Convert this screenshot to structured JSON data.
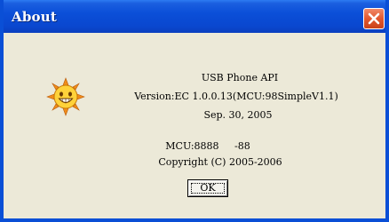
{
  "window": {
    "title": "About"
  },
  "icons": {
    "app": "sun-smiley-icon",
    "close": "close-icon"
  },
  "colors": {
    "title_bar": "#0a4fd6",
    "close_button": "#e2582f",
    "dialog_background": "#ece9d8"
  },
  "info": {
    "product": "USB Phone API",
    "version": "Version:EC 1.0.0.13(MCU:98SimpleV1.1)",
    "date": "Sep. 30, 2005",
    "mcu": "MCU:8888     -88",
    "copyright": "Copyright (C) 2005-2006"
  },
  "buttons": {
    "ok_label": "OK"
  }
}
